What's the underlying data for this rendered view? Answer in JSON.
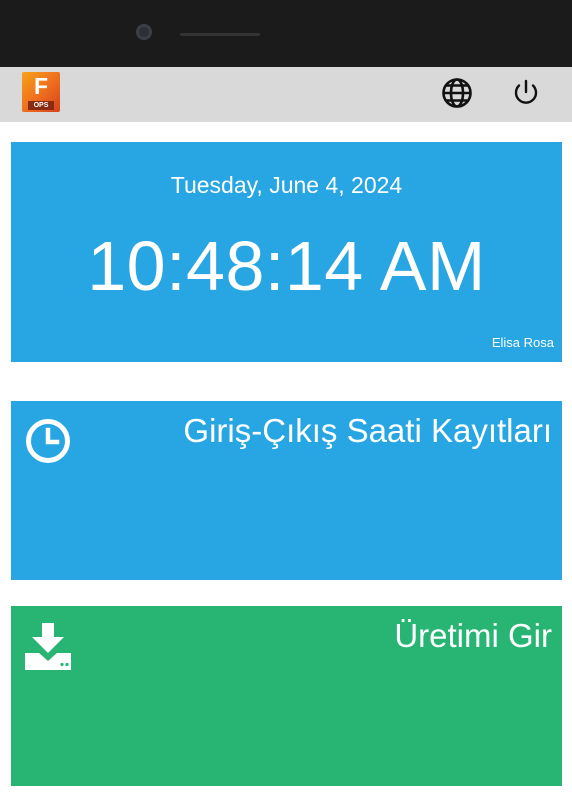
{
  "header": {
    "logo_letter": "F",
    "logo_sub": "OPS",
    "icons": [
      "globe-icon",
      "power-icon"
    ]
  },
  "clock": {
    "date": "Tuesday, June 4, 2024",
    "time": "10:48:14 AM",
    "user": "Elisa Rosa"
  },
  "tiles": {
    "attendance": {
      "label": "Giriş-Çıkış Saati Kayıtları",
      "icon": "clock-icon"
    },
    "production": {
      "label": "Üretimi Gir",
      "icon": "download-icon"
    }
  },
  "colors": {
    "header_bg": "#d9d9d9",
    "blue_tile": "#27a6e3",
    "green_tile": "#28b574",
    "logo_orange": "#f28a1c"
  }
}
